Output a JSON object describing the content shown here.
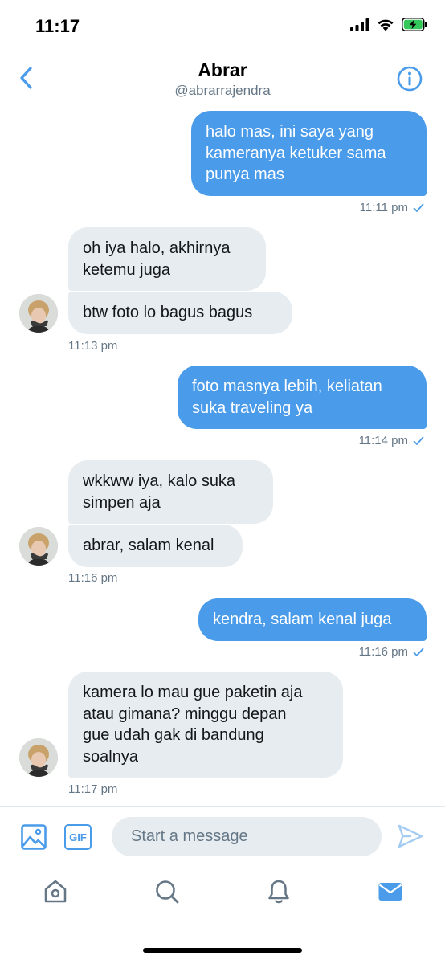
{
  "status_bar": {
    "time": "11:17"
  },
  "header": {
    "name": "Abrar",
    "handle": "@abrarrajendra"
  },
  "messages": [
    {
      "text": "halo mas, ini saya yang\nkameranya ketuker sama\npunya mas",
      "direction": "outgoing"
    },
    {
      "text": "11:11 pm",
      "type": "timestamp"
    },
    {
      "text": "oh iya halo, akhirnya\nketemu juga",
      "direction": "incoming"
    },
    {
      "text": "btw foto lo bagus bagus",
      "direction": "incoming"
    },
    {
      "text": "11:13 pm",
      "type": "timestamp"
    },
    {
      "text": "foto masnya lebih, keliatan\nsuka traveling ya",
      "direction": "outgoing"
    },
    {
      "text": "11:14 pm",
      "type": "timestamp"
    },
    {
      "text": "wkkww iya, kalo suka\nsimpen aja",
      "direction": "incoming"
    },
    {
      "text": "abrar, salam kenal",
      "direction": "incoming"
    },
    {
      "text": "11:16 pm",
      "type": "timestamp"
    },
    {
      "text": "kendra, salam kenal juga",
      "direction": "outgoing"
    },
    {
      "text": "11:16 pm",
      "type": "timestamp"
    },
    {
      "text": "kamera lo mau gue paketin aja\natau gimana? minggu depan\ngue udah gak di bandung\nsoalnya",
      "direction": "incoming"
    },
    {
      "text": "11:17 pm",
      "type": "timestamp"
    }
  ],
  "composer": {
    "placeholder": "Start a message",
    "gif_label": "GIF"
  },
  "icons": {
    "back": "chevron-left-icon",
    "info": "info-icon",
    "read_receipt": "checkmark-icon",
    "image": "image-icon",
    "send": "send-icon",
    "tabs": [
      "home-icon",
      "search-icon",
      "bell-icon",
      "mail-icon"
    ]
  },
  "colors": {
    "accent": "#4a9bea",
    "outgoing_bubble": "#4a9bea",
    "incoming_bubble": "#e6ecf0",
    "secondary_text": "#657786"
  }
}
